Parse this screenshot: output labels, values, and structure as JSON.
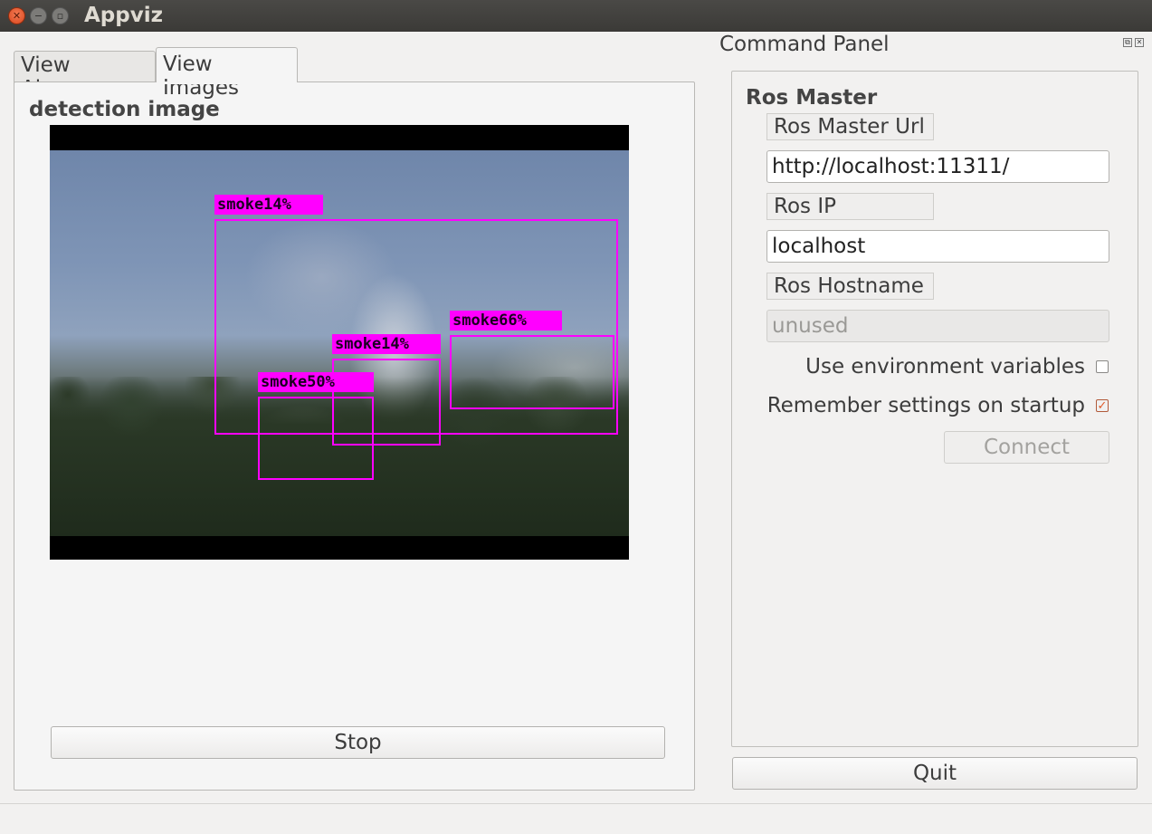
{
  "window": {
    "title": "Appviz"
  },
  "tabs": [
    {
      "label": "View Alarms",
      "active": false
    },
    {
      "label": "View Images",
      "active": true
    }
  ],
  "view_images": {
    "section_label": "detection image",
    "detections": [
      {
        "label": "smoke14%"
      },
      {
        "label": "smoke66%"
      },
      {
        "label": "smoke14%"
      },
      {
        "label": "smoke50%"
      }
    ],
    "stop_label": "Stop"
  },
  "command_panel": {
    "title": "Command Panel",
    "group_title": "Ros Master",
    "master_url_label": "Ros Master Url",
    "master_url_value": "http://localhost:11311/",
    "ip_label": "Ros IP",
    "ip_value": "localhost",
    "hostname_label": "Ros Hostname",
    "hostname_placeholder": "unused",
    "use_env_label": "Use environment variables",
    "use_env_checked": false,
    "remember_label": "Remember settings on startup",
    "remember_checked": true,
    "connect_label": "Connect",
    "quit_label": "Quit"
  },
  "colors": {
    "detection_box": "#ff00ff",
    "accent": "#e05a2a"
  }
}
